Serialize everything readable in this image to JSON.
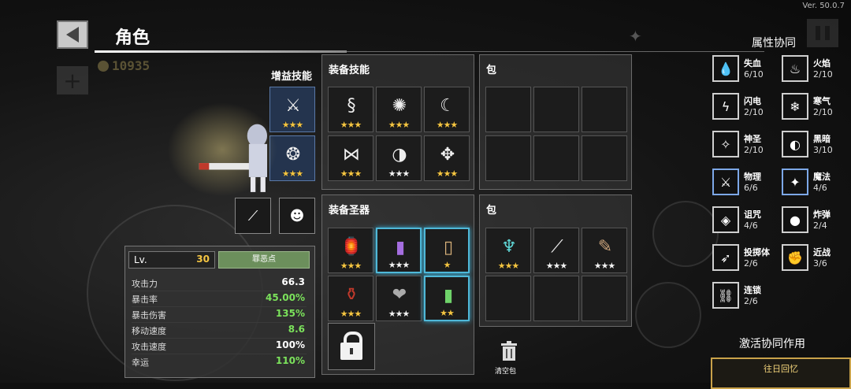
{
  "version": "Ver. 50.0.7",
  "header": {
    "title": "角色",
    "coins": "10935"
  },
  "boost_skills": {
    "label": "增益技能",
    "slots": [
      {
        "icon": "rune-wings-icon",
        "stars": "★★★"
      },
      {
        "icon": "spiral-orb-icon",
        "stars": "★★★"
      }
    ]
  },
  "equip_skills": {
    "label": "装备技能",
    "slots": [
      {
        "icon": "serpent-icon",
        "stars": "★★★"
      },
      {
        "icon": "shard-burst-icon",
        "stars": "★★★"
      },
      {
        "icon": "crescent-slash-icon",
        "stars": "★★★"
      },
      {
        "icon": "spiked-trap-icon",
        "stars": "★★★"
      },
      {
        "icon": "scythe-arc-icon",
        "stars": "★★★"
      },
      {
        "icon": "compass-sigil-icon",
        "stars": "★★★"
      }
    ]
  },
  "bag_top": {
    "label": "包"
  },
  "equip_relics": {
    "label": "装备圣器",
    "slots": [
      {
        "icon": "lantern-icon",
        "stars": "★★★"
      },
      {
        "icon": "purple-tome-icon",
        "stars": "★★★"
      },
      {
        "icon": "parchment-icon",
        "stars": "★"
      },
      {
        "icon": "red-potion-icon",
        "stars": "★★★"
      },
      {
        "icon": "stone-heart-icon",
        "stars": "★★★"
      },
      {
        "icon": "green-tome-icon",
        "stars": "★★"
      }
    ]
  },
  "bag_bottom": {
    "label": "包",
    "items": [
      {
        "icon": "crystal-fang-icon",
        "stars": "★★★"
      },
      {
        "icon": "dagger-icon",
        "stars": "★★★"
      },
      {
        "icon": "spiked-club-icon",
        "stars": "★★★"
      }
    ]
  },
  "weapons": [
    {
      "icon": "rifle-icon"
    },
    {
      "icon": "scarecrow-icon"
    }
  ],
  "stats": {
    "lv_label": "Lv.",
    "lv_value": "30",
    "karma_button": "罪恶点",
    "rows": [
      {
        "label": "攻击力",
        "value": "66.3",
        "color": "#ffffff"
      },
      {
        "label": "暴击率",
        "value": "45.00%",
        "color": "#7be25b"
      },
      {
        "label": "暴击伤害",
        "value": "135%",
        "color": "#7be25b"
      },
      {
        "label": "移动速度",
        "value": "8.6",
        "color": "#7be25b"
      },
      {
        "label": "攻击速度",
        "value": "100%",
        "color": "#ffffff"
      },
      {
        "label": "幸运",
        "value": "110%",
        "color": "#7be25b"
      }
    ]
  },
  "trash": {
    "label": "清空包"
  },
  "synergy": {
    "title": "属性协同",
    "items": [
      {
        "name": "失血",
        "count": "6/10",
        "icon": "blood-drop-icon"
      },
      {
        "name": "火焰",
        "count": "2/10",
        "icon": "flame-icon"
      },
      {
        "name": "闪电",
        "count": "2/10",
        "icon": "lightning-icon"
      },
      {
        "name": "寒气",
        "count": "2/10",
        "icon": "snowflake-icon"
      },
      {
        "name": "神圣",
        "count": "2/10",
        "icon": "holy-star-icon"
      },
      {
        "name": "黑暗",
        "count": "3/10",
        "icon": "dark-moon-icon"
      },
      {
        "name": "物理",
        "count": "6/6",
        "icon": "sword-icon"
      },
      {
        "name": "魔法",
        "count": "4/6",
        "icon": "magic-star-icon"
      },
      {
        "name": "诅咒",
        "count": "4/6",
        "icon": "curse-eye-icon"
      },
      {
        "name": "炸弹",
        "count": "2/4",
        "icon": "bomb-icon"
      },
      {
        "name": "投掷体",
        "count": "2/6",
        "icon": "projectile-icon"
      },
      {
        "name": "近战",
        "count": "3/6",
        "icon": "fist-icon"
      },
      {
        "name": "连锁",
        "count": "2/6",
        "icon": "chain-icon"
      }
    ],
    "activate_label": "激活协同作用",
    "past_memory": "往日回忆"
  }
}
